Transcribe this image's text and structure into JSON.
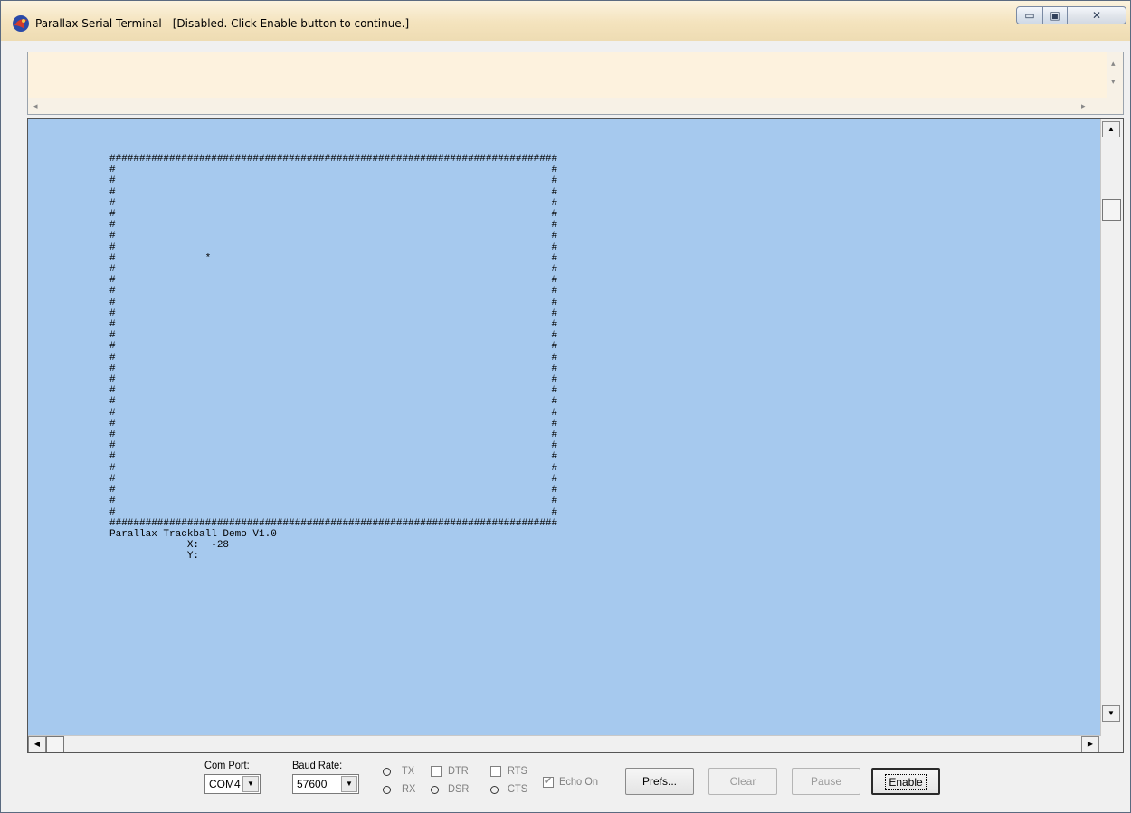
{
  "window": {
    "title": "Parallax Serial Terminal - [Disabled. Click Enable button to continue.]"
  },
  "terminal": {
    "lines": [
      "###########################################################################",
      "#                                                                         #",
      "#                                                                         #",
      "#                                                                         #",
      "#                                                                         #",
      "#                                                                         #",
      "#                                                                         #",
      "#                                                                         #",
      "#                                                                         #",
      "#               *                                                         #",
      "#                                                                         #",
      "#                                                                         #",
      "#                                                                         #",
      "#                                                                         #",
      "#                                                                         #",
      "#                                                                         #",
      "#                                                                         #",
      "#                                                                         #",
      "#                                                                         #",
      "#                                                                         #",
      "#                                                                         #",
      "#                                                                         #",
      "#                                                                         #",
      "#                                                                         #",
      "#                                                                         #",
      "#                                                                         #",
      "#                                                                         #",
      "#                                                                         #",
      "#                                                                         #",
      "#                                                                         #",
      "#                                                                         #",
      "#                                                                         #",
      "#                                                                         #",
      "###########################################################################",
      "Parallax Trackball Demo V1.0",
      "             X:  -28",
      "             Y:"
    ]
  },
  "controls": {
    "com_port_label": "Com Port:",
    "com_port_value": "COM4",
    "baud_rate_label": "Baud Rate:",
    "baud_rate_value": "57600",
    "tx_label": "TX",
    "rx_label": "RX",
    "dtr_label": "DTR",
    "dsr_label": "DSR",
    "rts_label": "RTS",
    "cts_label": "CTS",
    "echo_label": "Echo On",
    "echo_checked": true,
    "prefs_label": "Prefs...",
    "clear_label": "Clear",
    "pause_label": "Pause",
    "enable_label": "Enable"
  },
  "icons": {
    "app": "parallax-app-icon",
    "minimize": "minimize-icon",
    "maximize": "maximize-icon",
    "close": "close-icon"
  }
}
